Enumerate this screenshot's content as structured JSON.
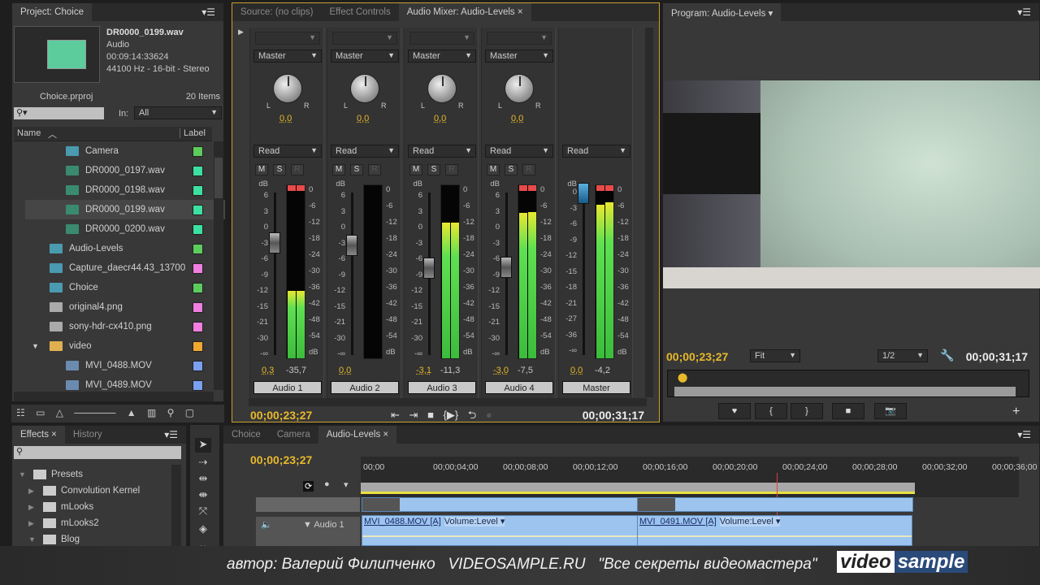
{
  "project": {
    "tab": "Project: Choice",
    "clip_name": "DR0000_0199.wav",
    "clip_type": "Audio",
    "clip_duration": "00:09:14:33624",
    "clip_format": "44100 Hz - 16-bit - Stereo",
    "project_file": "Choice.prproj",
    "item_count": "20 Items",
    "in_label": "In:",
    "in_value": "All",
    "col_name": "Name",
    "col_label": "Label",
    "items": [
      {
        "name": "Camera",
        "icon": "sequence-icon",
        "color": "#5ccc5c",
        "indent": 1
      },
      {
        "name": "DR0000_0197.wav",
        "icon": "audio-file-icon",
        "color": "#3ce0a0",
        "indent": 1
      },
      {
        "name": "DR0000_0198.wav",
        "icon": "audio-file-icon",
        "color": "#3ce0a0",
        "indent": 1
      },
      {
        "name": "DR0000_0199.wav",
        "icon": "audio-file-icon",
        "color": "#3ce0a0",
        "indent": 1
      },
      {
        "name": "DR0000_0200.wav",
        "icon": "audio-file-icon",
        "color": "#3ce0a0",
        "indent": 1
      },
      {
        "name": "Audio-Levels",
        "icon": "sequence-icon",
        "color": "#5ccc5c",
        "indent": 0
      },
      {
        "name": "Capture_daecr44.43_13700",
        "icon": "sequence-icon",
        "color": "#f07ee0",
        "indent": 0
      },
      {
        "name": "Choice",
        "icon": "sequence-icon",
        "color": "#5ccc5c",
        "indent": 0
      },
      {
        "name": "original4.png",
        "icon": "image-file-icon",
        "color": "#f07ee0",
        "indent": 0
      },
      {
        "name": "sony-hdr-cx410.png",
        "icon": "image-file-icon",
        "color": "#f07ee0",
        "indent": 0
      },
      {
        "name": "video",
        "icon": "folder-icon",
        "color": "#f0a830",
        "indent": 0
      },
      {
        "name": "MVI_0488.MOV",
        "icon": "video-file-icon",
        "color": "#7aa0f0",
        "indent": 1
      },
      {
        "name": "MVI_0489.MOV",
        "icon": "video-file-icon",
        "color": "#7aa0f0",
        "indent": 1
      }
    ]
  },
  "center_tabs": [
    "Source: (no clips)",
    "Effect Controls",
    "Audio Mixer: Audio-Levels"
  ],
  "mixer": {
    "channels": [
      {
        "name": "Audio 1",
        "output": "Master",
        "pan": "0,0",
        "automation": "Read",
        "volume": "0,3",
        "fader_db": 0.3,
        "level": "-35,7",
        "meter_db": [
          -35.7,
          -35.7
        ],
        "peak": true
      },
      {
        "name": "Audio 2",
        "output": "Master",
        "pan": "0,0",
        "automation": "Read",
        "volume": "0,0",
        "fader_db": 0,
        "level": "",
        "meter_db": [
          -60,
          -60
        ],
        "peak": false
      },
      {
        "name": "Audio 3",
        "output": "Master",
        "pan": "0,0",
        "automation": "Read",
        "volume": "-3,1",
        "fader_db": -3.1,
        "level": "-11,3",
        "meter_db": [
          -11.5,
          -11.3
        ],
        "peak": false
      },
      {
        "name": "Audio 4",
        "output": "Master",
        "pan": "0,0",
        "automation": "Read",
        "volume": "-3,0",
        "fader_db": -3.0,
        "level": "-7,5",
        "meter_db": [
          -8,
          -7.5
        ],
        "peak": true
      },
      {
        "name": "Master",
        "output": "",
        "pan": "",
        "automation": "Read",
        "volume": "0,0",
        "fader_db": 0,
        "level": "-4,2",
        "meter_db": [
          -5,
          -4.2
        ],
        "peak": true,
        "master": true
      }
    ],
    "fader_scale": [
      "6",
      "3",
      "0",
      "-3",
      "-6",
      "-9",
      "-12",
      "-15",
      "-21",
      "-30",
      "-∞"
    ],
    "master_fader_scale": [
      "0",
      "-3",
      "-6",
      "-9",
      "-12",
      "-15",
      "-18",
      "-21",
      "-27",
      "-36",
      "-∞"
    ],
    "meter_scale": [
      "0",
      "-6",
      "-12",
      "-18",
      "-24",
      "-30",
      "-36",
      "-42",
      "-48",
      "-54",
      "dB"
    ],
    "db_label": "dB",
    "mute": "M",
    "solo": "S",
    "record": "R",
    "current_time": "00;00;23;27",
    "duration": "00;00;31;17"
  },
  "program": {
    "tab": "Program: Audio-Levels",
    "current_time": "00;00;23;27",
    "fit": "Fit",
    "resolution": "1/2",
    "duration": "00;00;31;17"
  },
  "effects": {
    "tabs": [
      "Effects",
      "History"
    ],
    "items": [
      {
        "name": "Presets",
        "expanded": true,
        "indent": 0
      },
      {
        "name": "Convolution Kernel",
        "expanded": false,
        "indent": 1
      },
      {
        "name": "mLooks",
        "expanded": false,
        "indent": 1
      },
      {
        "name": "mLooks2",
        "expanded": false,
        "indent": 1
      },
      {
        "name": "Blog",
        "expanded": true,
        "indent": 1
      }
    ]
  },
  "timeline": {
    "tabs": [
      "Choice",
      "Camera",
      "Audio-Levels"
    ],
    "current_time": "00;00;23;27",
    "ruler": [
      "00;00",
      "00;00;04;00",
      "00;00;08;00",
      "00;00;12;00",
      "00;00;16;00",
      "00;00;20;00",
      "00;00;24;00",
      "00;00;28;00",
      "00;00;32;00",
      "00;00;36;00"
    ],
    "audio_track": "Audio 1",
    "clips": [
      {
        "name": "MVI_0488.MOV [A]",
        "fx": "Volume:Level"
      },
      {
        "name": "MVI_0491.MOV [A]",
        "fx": "Volume:Level"
      }
    ]
  },
  "watermark": {
    "caption": "автор: Валерий Филипченко   VIDEOSAMPLE.RU   \"Все секреты видеомастера\"",
    "logo": "video sample"
  }
}
